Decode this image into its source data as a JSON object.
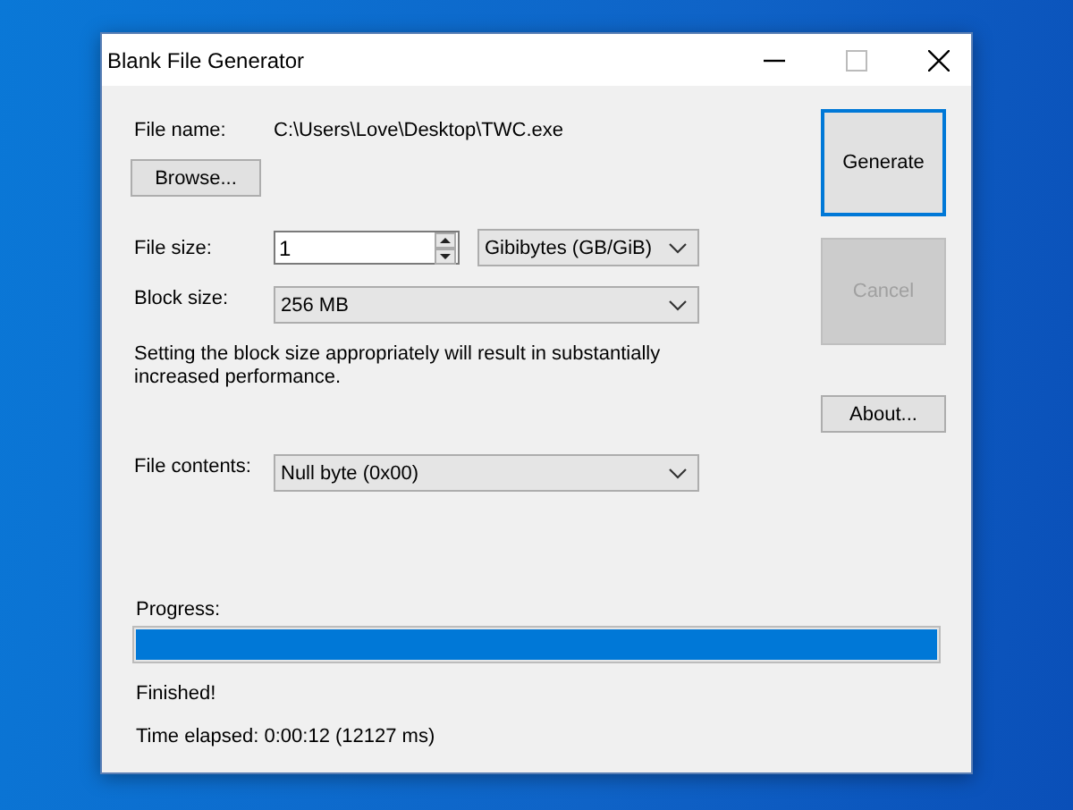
{
  "window": {
    "title": "Blank File Generator"
  },
  "file_name": {
    "label": "File name:",
    "value": "C:\\Users\\Love\\Desktop\\TWC.exe"
  },
  "browse_button": {
    "label": "Browse..."
  },
  "file_size": {
    "label": "File size:",
    "value": "1",
    "unit": "Gibibytes (GB/GiB)"
  },
  "block_size": {
    "label": "Block size:",
    "value": "256 MB"
  },
  "note": "Setting the block size appropriately will result in substantially increased performance.",
  "file_contents": {
    "label": "File contents:",
    "value": "Null byte (0x00)"
  },
  "buttons": [
    {
      "label": "Generate",
      "focused": true,
      "disabled": false
    },
    {
      "label": "Cancel",
      "focused": false,
      "disabled": true
    },
    {
      "label": "About...",
      "focused": false,
      "disabled": false
    }
  ],
  "progress": {
    "label": "Progress:",
    "level": 1
  },
  "status": "Finished!",
  "time_elapsed": "Time elapsed: 0:00:12 (12127 ms)"
}
